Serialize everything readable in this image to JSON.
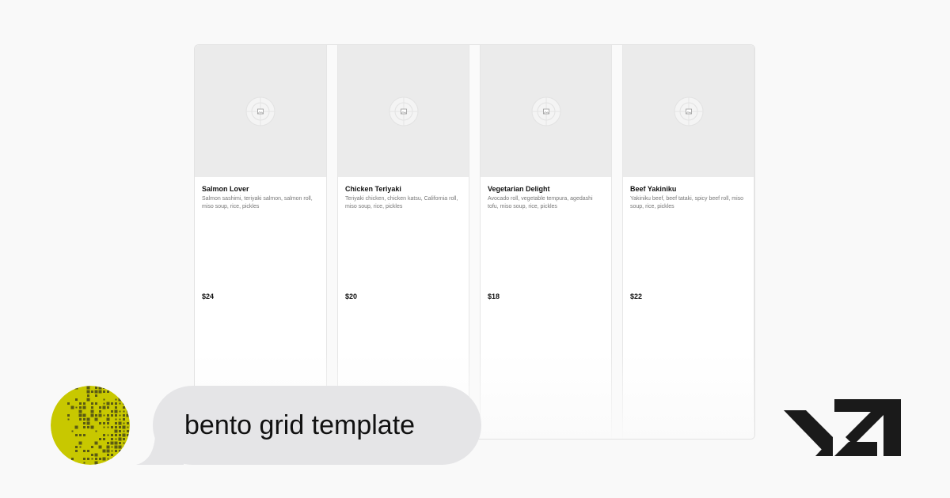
{
  "products": [
    {
      "title": "Salmon Lover",
      "description": "Salmon sashimi, teriyaki salmon, salmon roll, miso soup, rice, pickles",
      "price": "$24"
    },
    {
      "title": "Chicken Teriyaki",
      "description": "Teriyaki chicken, chicken katsu, California roll, miso soup, rice, pickles",
      "price": "$20"
    },
    {
      "title": "Vegetarian Delight",
      "description": "Avocado roll, vegetable tempura, agedashi tofu, miso soup, rice, pickles",
      "price": "$18"
    },
    {
      "title": "Beef Yakiniku",
      "description": "Yakiniku beef, beef tataki, spicy beef roll, miso soup, rice, pickles",
      "price": "$22"
    }
  ],
  "chat": {
    "message": "bento grid template"
  },
  "icons": {
    "image_placeholder": "image-icon",
    "avatar": "pixel-dither-avatar",
    "brand": "v0-logo"
  },
  "colors": {
    "avatar_yellow": "#c8c800",
    "avatar_dark": "#5a5a14",
    "bubble": "#e5e5e7",
    "logo": "#1a1a1a",
    "image_placeholder_bg": "#ebebeb"
  }
}
